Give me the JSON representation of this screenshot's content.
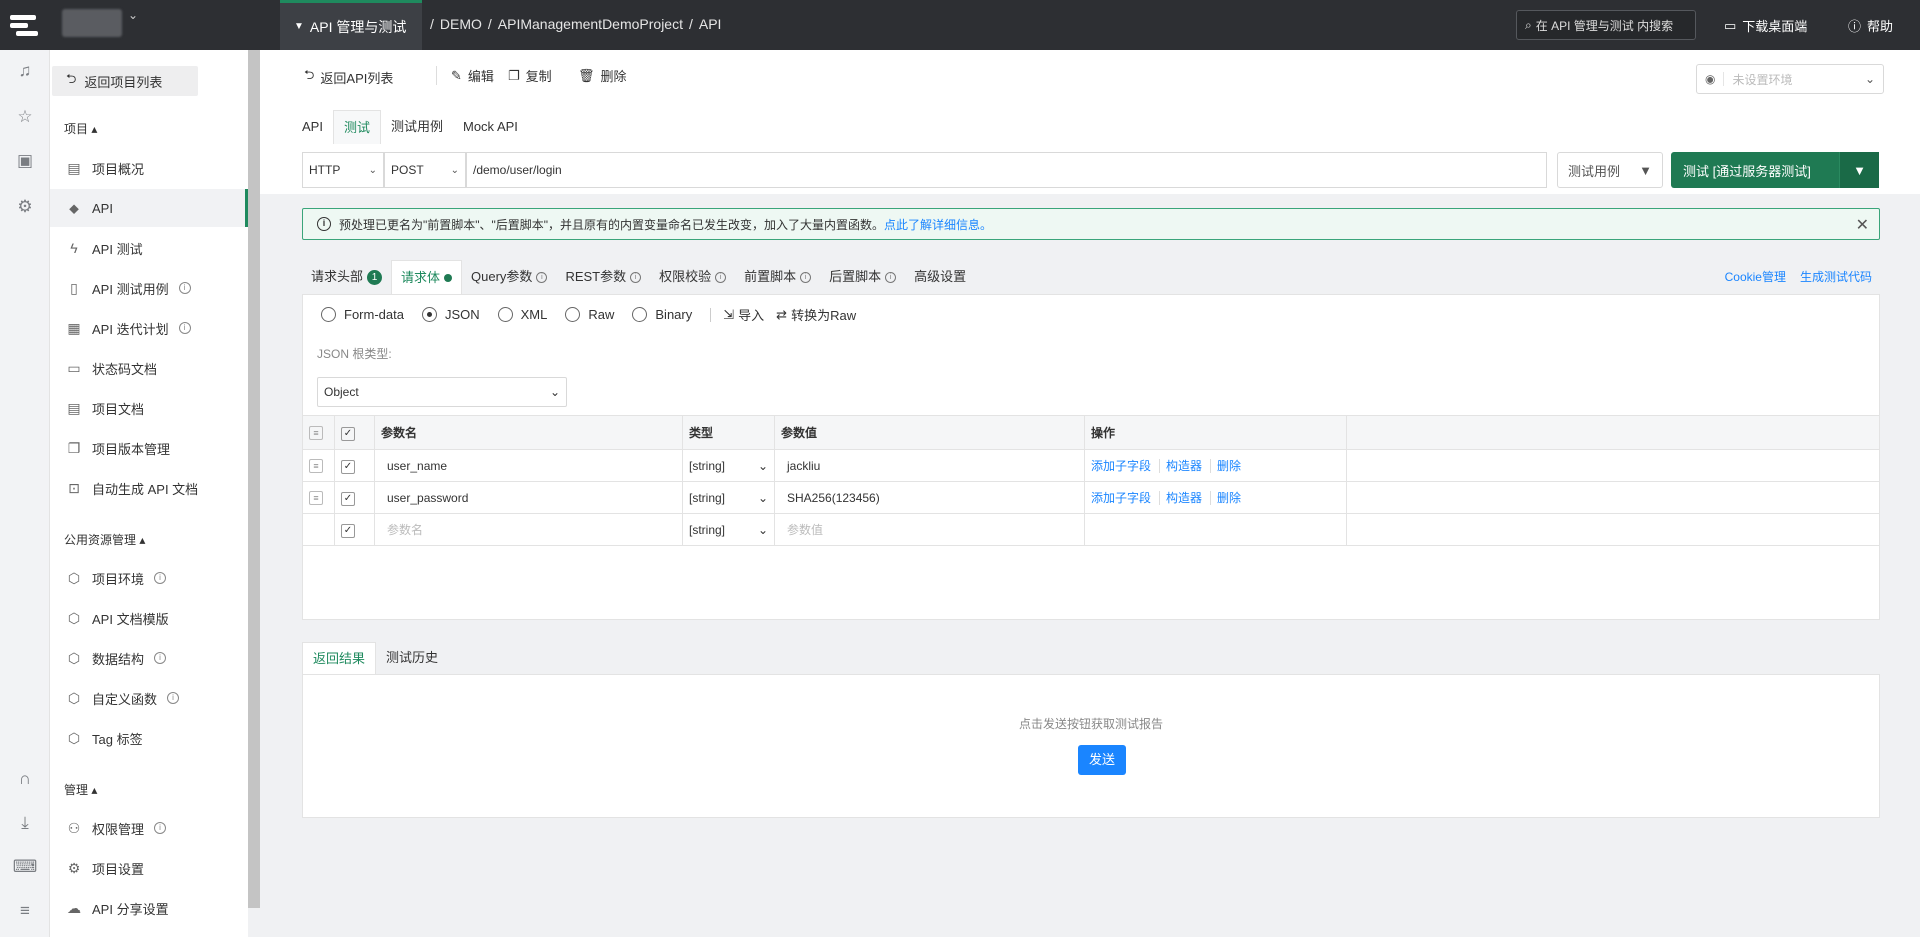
{
  "topbar": {
    "project_tab": "API 管理与测试",
    "breadcrumb": [
      "/",
      "DEMO",
      "/",
      "APIManagementDemoProject",
      "/",
      "API"
    ],
    "search_placeholder": "在 API 管理与测试 内搜索",
    "download": "下载桌面端",
    "help": "帮助"
  },
  "sidebar": {
    "back": "返回项目列表",
    "section_project": "项目 ▴",
    "items": [
      "项目概况",
      "API",
      "API 测试",
      "API 测试用例",
      "API 迭代计划",
      "状态码文档",
      "项目文档",
      "项目版本管理",
      "自动生成 API 文档"
    ],
    "section_public": "公用资源管理 ▴",
    "public_items": [
      "项目环境",
      "API 文档模版",
      "数据结构",
      "自定义函数",
      "Tag 标签"
    ],
    "section_admin": "管理 ▴",
    "admin_items": [
      "权限管理",
      "项目设置",
      "API 分享设置"
    ]
  },
  "toolbar": {
    "back": "返回API列表",
    "edit": "编辑",
    "copy": "复制",
    "delete": "删除",
    "env_placeholder": "未设置环境"
  },
  "tabs": [
    "API",
    "测试",
    "测试用例",
    "Mock API"
  ],
  "request": {
    "protocol": "HTTP",
    "method": "POST",
    "url": "/demo/user/login",
    "use_case": "测试用例",
    "test_button": "测试 [通过服务器测试]"
  },
  "notice": {
    "text": "预处理已更名为\"前置脚本\"、\"后置脚本\"，并且原有的内置变量命名已发生改变，加入了大量内置函数。",
    "link": "点此了解详细信息。"
  },
  "req_tabs": {
    "headers": "请求头部",
    "headers_count": "1",
    "body": "请求体",
    "query": "Query参数",
    "rest": "REST参数",
    "auth": "权限校验",
    "pre": "前置脚本",
    "post": "后置脚本",
    "advanced": "高级设置",
    "cookie": "Cookie管理",
    "gen_code": "生成测试代码"
  },
  "body": {
    "types": [
      "Form-data",
      "JSON",
      "XML",
      "Raw",
      "Binary"
    ],
    "selected": "JSON",
    "import": "导入",
    "to_raw": "转换为Raw",
    "root_label": "JSON 根类型:",
    "root_type": "Object",
    "columns": [
      "参数名",
      "类型",
      "参数值",
      "操作"
    ],
    "rows": [
      {
        "name": "user_name",
        "type": "[string]",
        "value": "jackliu"
      },
      {
        "name": "user_password",
        "type": "[string]",
        "value": "SHA256(123456)"
      }
    ],
    "new_row": {
      "name_ph": "参数名",
      "type": "[string]",
      "value_ph": "参数值"
    },
    "ops": [
      "添加子字段",
      "构造器",
      "删除"
    ]
  },
  "result": {
    "tabs": [
      "返回结果",
      "测试历史"
    ],
    "hint": "点击发送按钮获取测试报告",
    "send": "发送"
  }
}
